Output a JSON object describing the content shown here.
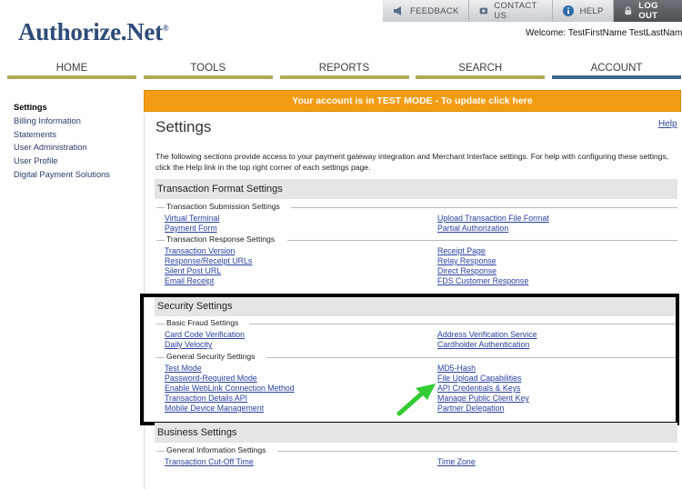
{
  "topbar": {
    "feedback": "FEEDBACK",
    "contact": "CONTACT US",
    "help": "HELP",
    "logout": "LOG OUT"
  },
  "brand": {
    "logo": "Authorize.Net",
    "tm": "®"
  },
  "welcome": "Welcome: TestFirstName TestLastName",
  "nav": {
    "tabs": [
      "HOME",
      "TOOLS",
      "REPORTS",
      "SEARCH",
      "ACCOUNT"
    ],
    "active": "ACCOUNT"
  },
  "sidebar": {
    "items": [
      "Settings",
      "Billing Information",
      "Statements",
      "User Administration",
      "User Profile",
      "Digital Payment Solutions"
    ],
    "active": "Settings"
  },
  "banner": "Your account is in TEST MODE - To update click here",
  "page": {
    "title": "Settings",
    "help": "Help",
    "intro": "The following sections provide access to your payment gateway integration and Merchant Interface settings. For help with configuring these settings, click the Help link in the top right corner of each settings page."
  },
  "sections": {
    "transaction_format": {
      "title": "Transaction Format Settings",
      "submission": {
        "title": "Transaction Submission Settings",
        "left": [
          "Virtual Terminal",
          "Payment Form"
        ],
        "right": [
          "Upload Transaction File Format",
          "Partial Authorization"
        ]
      },
      "response": {
        "title": "Transaction Response Settings",
        "left": [
          "Transaction Version",
          "Response/Receipt URLs",
          "Silent Post URL",
          "Email Receipt"
        ],
        "right": [
          "Receipt Page",
          "Relay Response",
          "Direct Response",
          "FDS Customer Response"
        ]
      }
    },
    "security": {
      "title": "Security Settings",
      "basic_fraud": {
        "title": "Basic Fraud Settings",
        "left": [
          "Card Code Verification",
          "Daily Velocity"
        ],
        "right": [
          "Address Verification Service",
          "Cardholder Authentication"
        ]
      },
      "general_security": {
        "title": "General Security Settings",
        "left": [
          "Test Mode",
          "Password-Required Mode",
          "Enable WebLink Connection Method",
          "Transaction Details API",
          "Mobile Device Management"
        ],
        "right": [
          "MD5-Hash",
          "File Upload Capabilities",
          "API Credentials & Keys",
          "Manage Public Client Key",
          "Partner Delegation"
        ]
      }
    },
    "business": {
      "title": "Business Settings",
      "general_info": {
        "title": "General Information Settings",
        "left": [
          "Transaction Cut-Off Time"
        ],
        "right": [
          "Time Zone"
        ]
      }
    }
  },
  "colors": {
    "banner": "#f39c12",
    "link": "#2a40a0",
    "arrow": "#33cc33",
    "nav_accent": "#b2aa58",
    "nav_active": "#3d6a8a"
  },
  "icons": {
    "feedback": "megaphone-icon",
    "contact": "phone-icon",
    "help": "info-icon",
    "logout": "lock-icon",
    "arrow": "green-arrow-icon"
  }
}
